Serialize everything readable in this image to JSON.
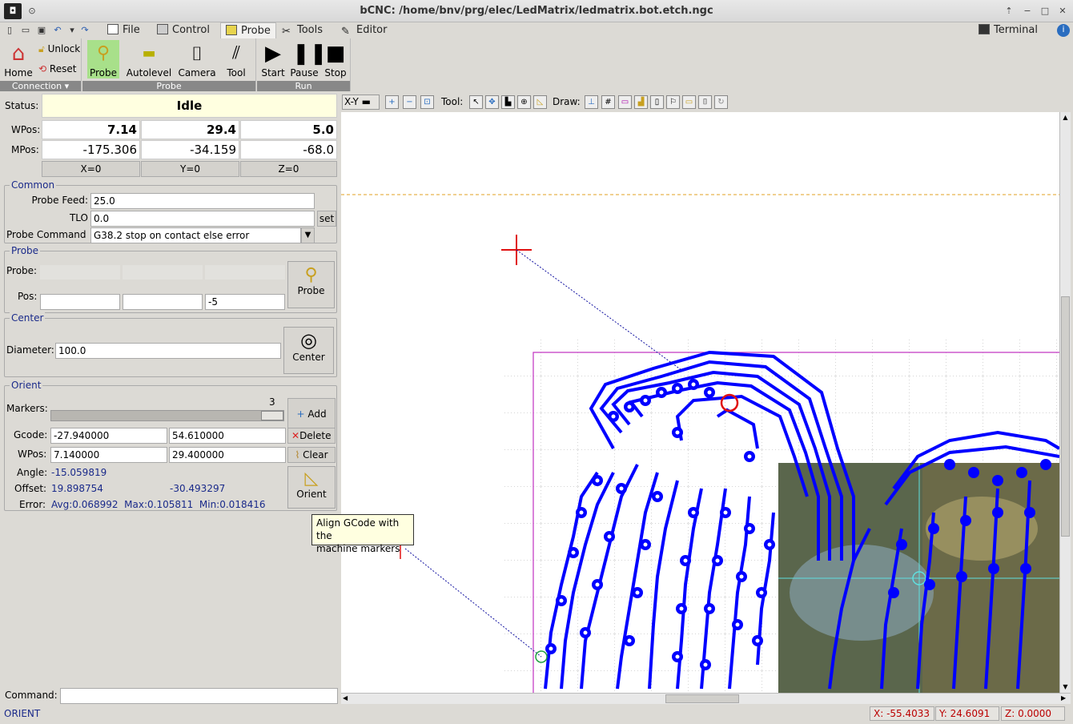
{
  "window": {
    "title": "bCNC: /home/bnv/prg/elec/LedMatrix/ledmatrix.bot.etch.ngc"
  },
  "menubar": {
    "tabs": [
      "File",
      "Control",
      "Probe",
      "Tools",
      "Editor"
    ],
    "terminal_label": "Terminal"
  },
  "ribbon": {
    "home_label": "Home",
    "unlock_label": "Unlock",
    "reset_label": "Reset",
    "connection_label": "Connection",
    "probe_label": "Probe",
    "autolevel_label": "Autolevel",
    "camera_label": "Camera",
    "tool_label": "Tool",
    "probe_group_label": "Probe",
    "start_label": "Start",
    "pause_label": "Pause",
    "stop_label": "Stop",
    "run_group_label": "Run"
  },
  "status": {
    "label": "Status:",
    "value": "Idle"
  },
  "wpos": {
    "label": "WPos:",
    "x": "7.14",
    "y": "29.4",
    "z": "5.0"
  },
  "mpos": {
    "label": "MPos:",
    "x": "-175.306",
    "y": "-34.159",
    "z": "-68.0"
  },
  "zero_buttons": {
    "x": "X=0",
    "y": "Y=0",
    "z": "Z=0"
  },
  "common": {
    "title": "Common",
    "probe_feed_label": "Probe Feed:",
    "probe_feed": "25.0",
    "tlo_label": "TLO",
    "tlo": "0.0",
    "set_label": "set",
    "probe_command_label": "Probe Command",
    "probe_command": "G38.2 stop on contact else error"
  },
  "probe": {
    "title": "Probe",
    "probe_label": "Probe:",
    "pos_label": "Pos:",
    "pos_z": "-5",
    "button_label": "Probe"
  },
  "center": {
    "title": "Center",
    "diameter_label": "Diameter:",
    "diameter": "100.0",
    "button_label": "Center"
  },
  "orient": {
    "title": "Orient",
    "markers_label": "Markers:",
    "markers_count": "3",
    "add_label": "Add",
    "gcode_label": "Gcode:",
    "gcode_x": "-27.940000",
    "gcode_y": "54.610000",
    "delete_label": "Delete",
    "wpos_label": "WPos:",
    "wpos_x": "7.140000",
    "wpos_y": "29.400000",
    "clear_label": "Clear",
    "angle_label": "Angle:",
    "angle": "-15.059819",
    "offset_label": "Offset:",
    "offset_x": "19.898754",
    "offset_y": "-30.493297",
    "error_label": "Error:",
    "error": "Avg:0.068992  Max:0.105811  Min:0.018416",
    "button_label": "Orient"
  },
  "tooltip": {
    "line1": "Align GCode with the",
    "line2": "machine markers"
  },
  "command": {
    "label": "Command:",
    "value": ""
  },
  "canvas_toolbar": {
    "view": "X-Y",
    "tool_label": "Tool:",
    "draw_label": "Draw:"
  },
  "statusbar": {
    "message": "ORIENT",
    "x": "X: -55.4033",
    "y": "Y: 24.6091",
    "z": "Z: 0.0000"
  },
  "colors": {
    "accent": "#1a2a8a",
    "toolpath": "#0000ff",
    "status_bg": "#ffffe0"
  }
}
